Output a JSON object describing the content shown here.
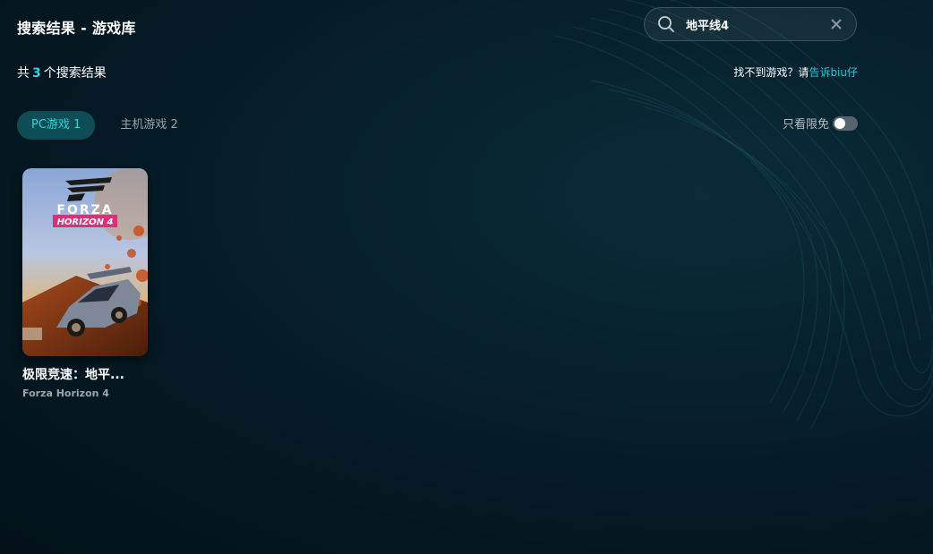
{
  "header": {
    "title": "搜索结果 - 游戏库"
  },
  "search": {
    "value": "地平线4",
    "placeholder": ""
  },
  "results": {
    "prefix": "共",
    "count": "3",
    "suffix": "个搜索结果"
  },
  "help": {
    "text": "找不到游戏？请",
    "link": "告诉biu仔"
  },
  "tabs": [
    {
      "label": "PC游戏 1",
      "active": true
    },
    {
      "label": "主机游戏 2",
      "active": false
    }
  ],
  "filter": {
    "label": "只看限免",
    "enabled": false
  },
  "games": [
    {
      "name": "极限竞速：地平...",
      "subtitle": "Forza Horizon 4",
      "cover": {
        "logo_line1": "FORZA",
        "logo_line2": "HORIZON 4"
      }
    }
  ],
  "icons": {
    "search": "search-icon",
    "clear": "close-icon",
    "toggle": "toggle-switch"
  },
  "colors": {
    "accent": "#2ed5d9",
    "link": "#22c7d6",
    "tab_active_bg": "#0f4d56"
  }
}
